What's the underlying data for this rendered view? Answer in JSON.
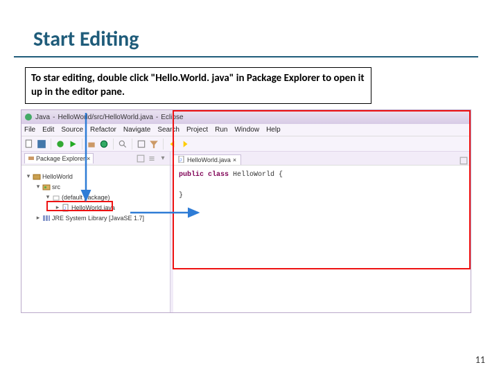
{
  "slide": {
    "title": "Start Editing",
    "instruction": "To star editing, double click \"Hello.World. java\" in Package Explorer to open it up in the editor pane.",
    "page_number": "11"
  },
  "ide": {
    "titlebar": {
      "perspective": "Java",
      "path": "HelloWorld/src/HelloWorld.java",
      "app": "Eclipse"
    },
    "menu": [
      "File",
      "Edit",
      "Source",
      "Refactor",
      "Navigate",
      "Search",
      "Project",
      "Run",
      "Window",
      "Help"
    ],
    "explorer": {
      "title": "Package Explorer",
      "project": "HelloWorld",
      "src": "src",
      "pkg": "(default package)",
      "file": "HelloWorld.java",
      "jre": "JRE System Library [JavaSE 1.7]"
    },
    "editor": {
      "tab": "HelloWorld.java",
      "code_line1_kw": "public class",
      "code_line1_rest": " HelloWorld {",
      "code_line2": "}"
    }
  }
}
